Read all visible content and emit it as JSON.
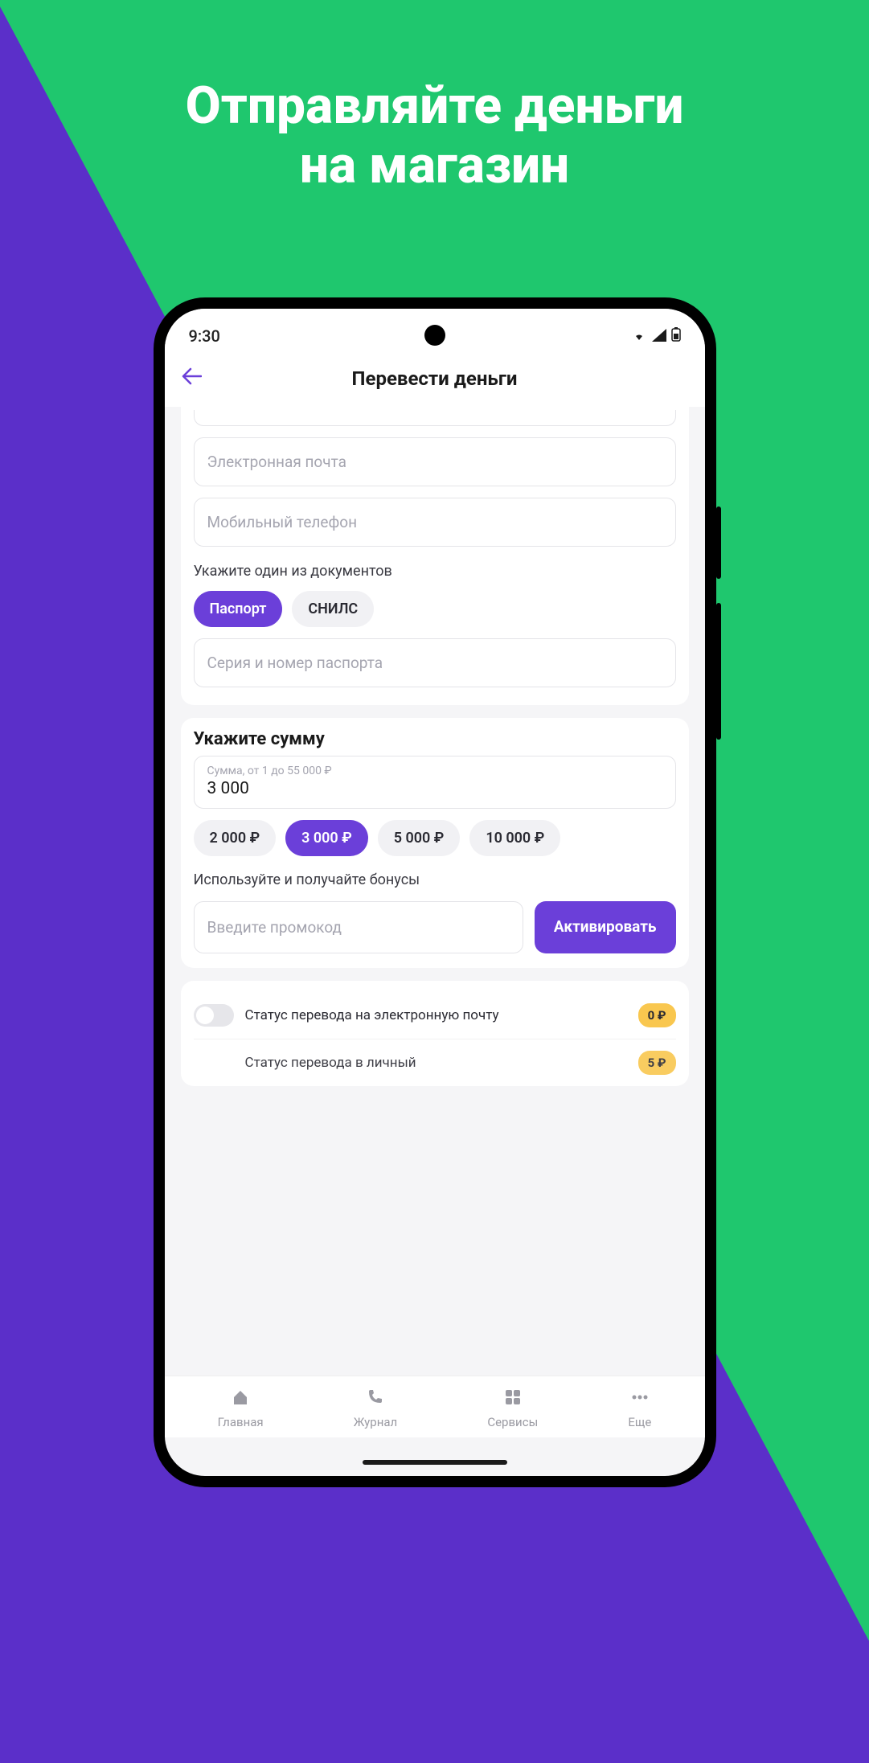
{
  "promo": {
    "headline_line1": "Отправляйте деньги",
    "headline_line2": "на магазин"
  },
  "statusbar": {
    "time": "9:30"
  },
  "header": {
    "title": "Перевести деньги"
  },
  "form": {
    "email_placeholder": "Электронная почта",
    "phone_placeholder": "Мобильный телефон",
    "doc_label": "Укажите один из документов",
    "doc_chips": [
      "Паспорт",
      "СНИЛС"
    ],
    "passport_placeholder": "Серия и номер паспорта"
  },
  "amount": {
    "title": "Укажите сумму",
    "label": "Сумма, от 1 до 55 000 ₽",
    "value": "3 000",
    "presets": [
      "2 000 ₽",
      "3 000 ₽",
      "5 000 ₽",
      "10 000 ₽"
    ],
    "promo_label": "Используйте и получайте бонусы",
    "promo_placeholder": "Введите промокод",
    "activate": "Активировать"
  },
  "statuses": [
    {
      "text": "Статус перевода на электронную почту",
      "badge": "0 ₽"
    },
    {
      "text": "Статус перевода в личный",
      "badge": "5 ₽"
    }
  ],
  "nav": {
    "home": "Главная",
    "journal": "Журнал",
    "services": "Сервисы",
    "more": "Еще"
  }
}
